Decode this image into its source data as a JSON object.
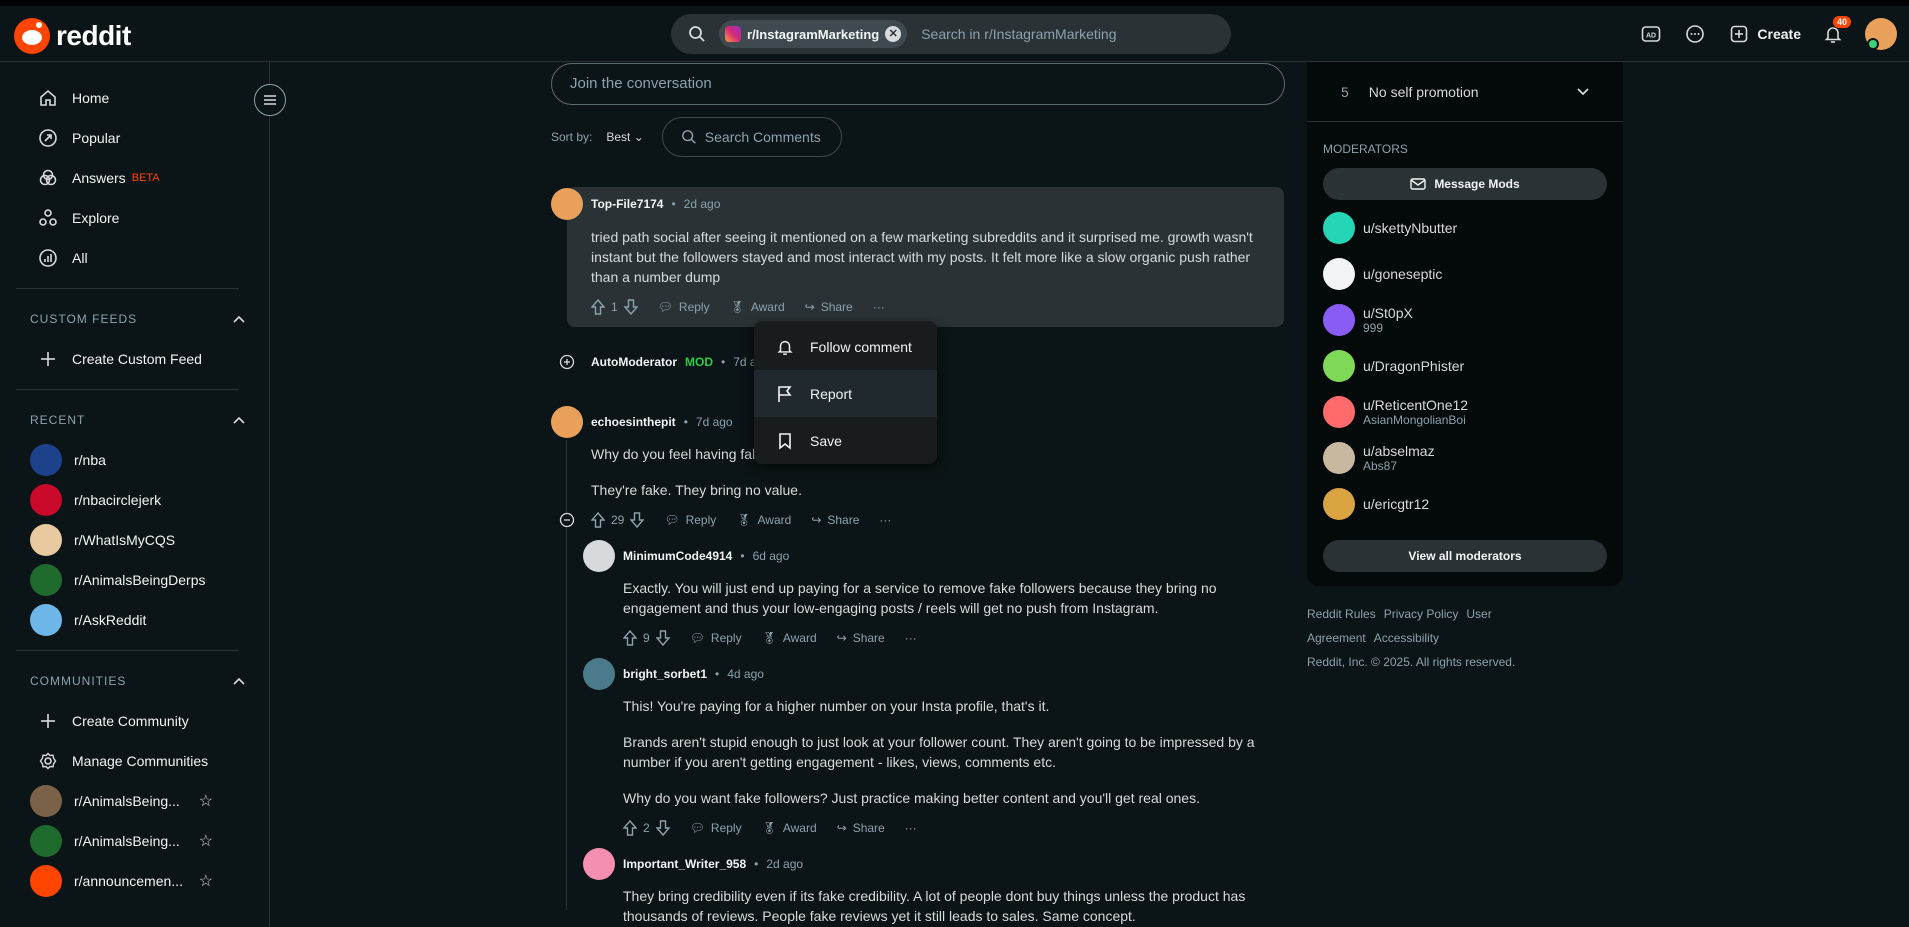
{
  "brand": {
    "name": "reddit"
  },
  "search": {
    "community": "r/InstagramMarketing",
    "placeholder": "Search in r/InstagramMarketing"
  },
  "header": {
    "create_label": "Create",
    "notification_count": "40"
  },
  "sidebar": {
    "nav": [
      {
        "label": "Home",
        "icon": "home-icon"
      },
      {
        "label": "Popular",
        "icon": "popular-icon"
      },
      {
        "label": "Answers",
        "icon": "answers-icon",
        "badge": "BETA"
      },
      {
        "label": "Explore",
        "icon": "explore-icon"
      },
      {
        "label": "All",
        "icon": "all-icon"
      }
    ],
    "custom_feeds": {
      "heading": "CUSTOM FEEDS",
      "create": "Create Custom Feed"
    },
    "recent": {
      "heading": "RECENT",
      "items": [
        "r/nba",
        "r/nbacirclejerk",
        "r/WhatIsMyCQS",
        "r/AnimalsBeingDerps",
        "r/AskReddit"
      ]
    },
    "communities": {
      "heading": "COMMUNITIES",
      "create": "Create Community",
      "manage": "Manage Communities",
      "items": [
        "r/AnimalsBeing...",
        "r/AnimalsBeing...",
        "r/announcemen..."
      ]
    }
  },
  "main": {
    "join_placeholder": "Join the conversation",
    "sort_label": "Sort by:",
    "sort_value": "Best",
    "search_comments": "Search Comments"
  },
  "comments": [
    {
      "user": "Top-File7174",
      "time": "2d ago",
      "body": "tried path social after seeing it mentioned on a few marketing subreddits and it surprised me.  growth wasn't instant but the followers stayed and most interact with my posts. It felt more like a slow organic push rather than a number dump",
      "votes": "1"
    },
    {
      "user": "AutoModerator",
      "badge": "MOD",
      "time": "7d ago"
    },
    {
      "user": "echoesinthepit",
      "time": "7d ago",
      "body1": "Why do you feel having fal",
      "body2": "They're fake. They bring no value.",
      "votes": "29"
    },
    {
      "user": "MinimumCode4914",
      "time": "6d ago",
      "body": "Exactly. You will just end up paying for a service to remove fake followers because they bring no engagement and thus your low-engaging posts / reels will get no push from Instagram.",
      "votes": "9"
    },
    {
      "user": "bright_sorbet1",
      "time": "4d ago",
      "p1": "This! You're paying for a higher number on your Insta profile, that's it.",
      "p2": "Brands aren't stupid enough to just look at your follower count. They aren't going to be impressed by a number if you aren't getting engagement - likes, views, comments etc.",
      "p3": "Why do you want fake followers? Just practice making better content and you'll get real ones.",
      "votes": "2"
    },
    {
      "user": "Important_Writer_958",
      "time": "2d ago",
      "body": "They bring credibility even if its fake credibility. A lot of people dont buy things unless the product has thousands of reviews. People fake reviews yet it still leads to sales. Same concept."
    }
  ],
  "actions": {
    "reply": "Reply",
    "award": "Award",
    "share": "Share",
    "more": "···",
    "sep": "•"
  },
  "context_menu": {
    "items": [
      "Follow comment",
      "Report",
      "Save"
    ]
  },
  "right": {
    "rule": {
      "number": "5",
      "text": "No self promotion"
    },
    "moderators_heading": "MODERATORS",
    "message_mods": "Message Mods",
    "moderators": [
      {
        "name": "u/skettyNbutter",
        "flair": "",
        "color": "#24d5b6"
      },
      {
        "name": "u/goneseptic",
        "flair": "",
        "color": "#f2f4f5"
      },
      {
        "name": "u/St0pX",
        "flair": "999",
        "color": "#8a5cf6"
      },
      {
        "name": "u/DragonPhister",
        "flair": "",
        "color": "#7ed957"
      },
      {
        "name": "u/ReticentOne12",
        "flair": "AsianMongolianBoi",
        "color": "#ff6b6b"
      },
      {
        "name": "u/abselmaz",
        "flair": "Abs87",
        "color": "#c9b8a0"
      },
      {
        "name": "u/ericgtr12",
        "flair": "",
        "color": "#d9a441"
      }
    ],
    "view_all": "View all moderators",
    "footer_links": [
      "Reddit Rules",
      "Privacy Policy",
      "User Agreement",
      "Accessibility"
    ],
    "copyright": "Reddit, Inc. © 2025. All rights reserved."
  },
  "colors": {
    "accent": "#ff4500",
    "background": "#0b1416",
    "mod_green": "#2ecc40"
  }
}
